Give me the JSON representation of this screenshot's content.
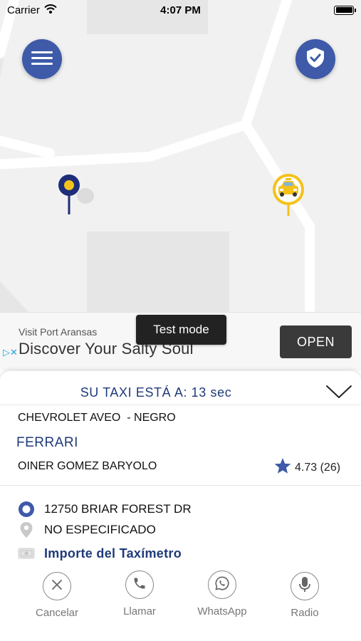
{
  "status_bar": {
    "carrier": "Carrier",
    "time": "4:07 PM"
  },
  "ad": {
    "subtitle": "Visit Port Aransas",
    "title": "Discover Your Salty Soul",
    "cta": "OPEN",
    "test_mode": "Test mode",
    "choices_glyphs": "▷✕"
  },
  "trip": {
    "eta": "SU TAXI ESTÁ A: 13 sec",
    "car": "CHEVROLET AVEO  - NEGRO",
    "company": "FERRARI",
    "driver": "OINER GOMEZ BARYOLO",
    "rating": "4.73 (26)",
    "pickup": "12750 BRIAR FOREST DR",
    "destination": "NO ESPECIFICADO",
    "fare": "Importe del Taxímetro"
  },
  "actions": {
    "cancel": "Cancelar",
    "call": "Llamar",
    "whatsapp": "WhatsApp",
    "radio": "Radio"
  },
  "colors": {
    "primary": "#3e5aa8",
    "dark_blue": "#1f3a7a",
    "taxi_yellow": "#f4c21a",
    "pin_navy": "#1e2d78"
  },
  "icons": [
    "menu-icon",
    "shield-check-icon",
    "pickup-pin-icon",
    "taxi-marker-icon",
    "chevron-down-icon",
    "star-icon",
    "radio-dot-icon",
    "location-pin-icon",
    "cash-icon",
    "close-icon",
    "phone-icon",
    "whatsapp-icon",
    "microphone-icon",
    "wifi-icon",
    "battery-icon"
  ]
}
